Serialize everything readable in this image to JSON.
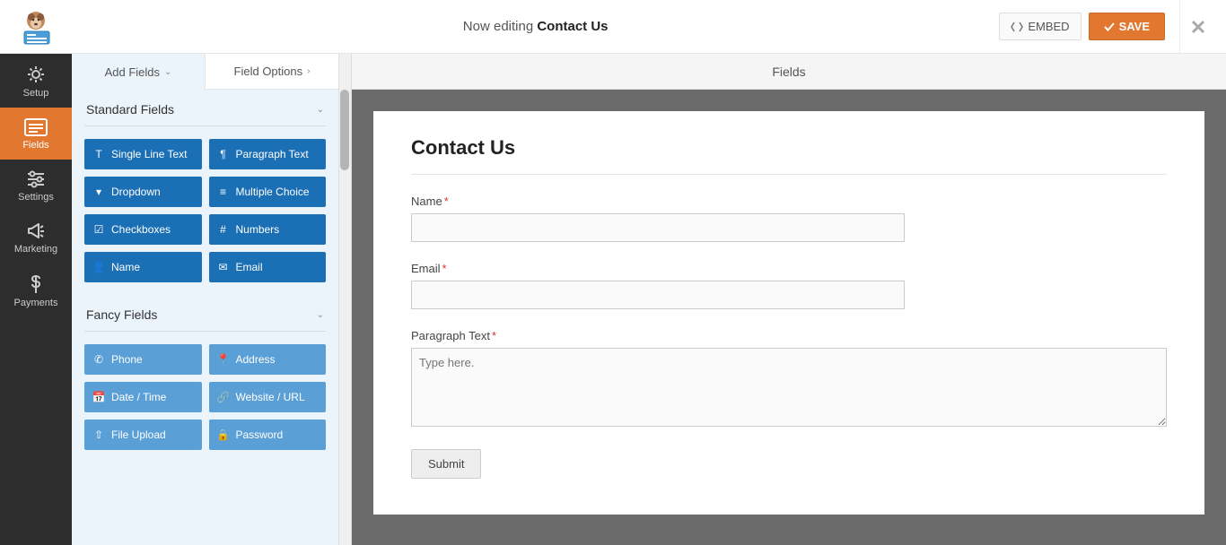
{
  "header": {
    "editing_prefix": "Now editing ",
    "form_name": "Contact Us",
    "embed_label": "EMBED",
    "save_label": "SAVE"
  },
  "nav": {
    "setup": "Setup",
    "fields": "Fields",
    "settings": "Settings",
    "marketing": "Marketing",
    "payments": "Payments"
  },
  "panel": {
    "tab_add": "Add Fields",
    "tab_options": "Field Options",
    "section_standard": "Standard Fields",
    "section_fancy": "Fancy Fields",
    "standard": [
      "Single Line Text",
      "Paragraph Text",
      "Dropdown",
      "Multiple Choice",
      "Checkboxes",
      "Numbers",
      "Name",
      "Email"
    ],
    "fancy": [
      "Phone",
      "Address",
      "Date / Time",
      "Website / URL",
      "File Upload",
      "Password"
    ]
  },
  "canvas": {
    "area_title": "Fields",
    "form_title": "Contact Us",
    "fields": {
      "name": {
        "label": "Name",
        "required": "*"
      },
      "email": {
        "label": "Email",
        "required": "*"
      },
      "paragraph": {
        "label": "Paragraph Text",
        "required": "*",
        "placeholder": "Type here."
      }
    },
    "submit_label": "Submit"
  }
}
